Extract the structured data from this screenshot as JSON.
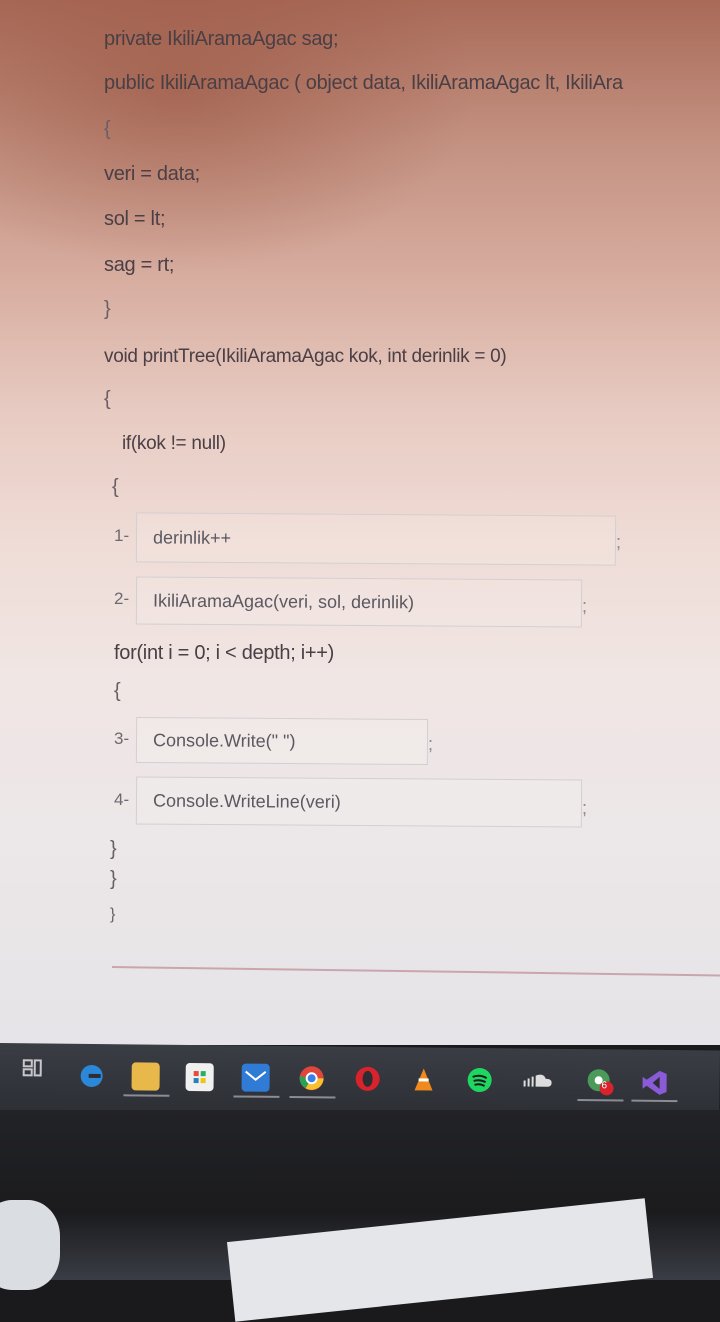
{
  "code": {
    "line_private": "private IkiliAramaAgac  sag;",
    "line_ctor": "public IkiliAramaAgac  ( object data, IkiliAramaAgac lt, IkiliAra",
    "brace_open": "{",
    "brace_close": "}",
    "line_veri": "veri = data;",
    "line_sol": "sol = lt;",
    "line_sag": "sag = rt;",
    "line_print": "void printTree(IkiliAramaAgac kok, int derinlik = 0)",
    "line_if": "if(kok != null)",
    "line_for": "for(int i = 0; i < depth; i++)"
  },
  "blanks": [
    {
      "label": "1-",
      "answer": "derinlik++",
      "suffix": ";"
    },
    {
      "label": "2-",
      "answer": "IkiliAramaAgac(veri, sol, derinlik)",
      "suffix": ";"
    },
    {
      "label": "3-",
      "answer": "Console.Write(\" \")",
      "suffix": ";"
    },
    {
      "label": "4-",
      "answer": "Console.WriteLine(veri)",
      "suffix": ";"
    }
  ],
  "taskbar": {
    "icons": [
      "task-view-icon",
      "edge-icon",
      "file-explorer-icon",
      "store-icon",
      "mail-icon",
      "chrome-icon",
      "opera-icon",
      "vlc-icon",
      "spotify-icon",
      "soundcloud-icon",
      "chrome-profile-icon",
      "visual-studio-icon"
    ],
    "badge_count": "6"
  },
  "colors": {
    "code_text": "#4a3f45",
    "taskbar_bg": "#2c2e34",
    "divider": "#c9a6ad"
  }
}
